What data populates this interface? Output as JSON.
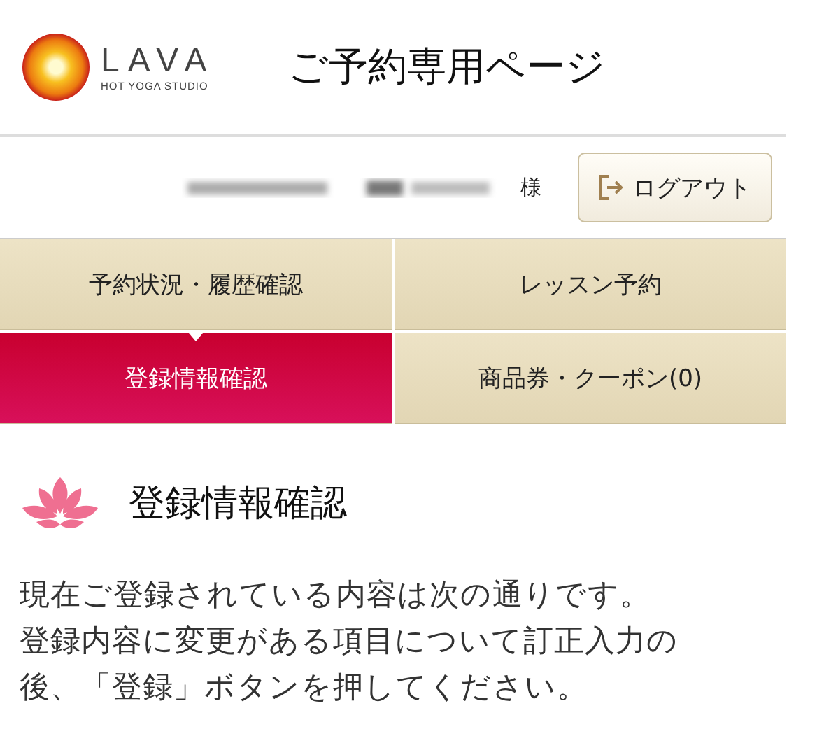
{
  "header": {
    "logo": {
      "name": "LAVA",
      "tagline": "HOT YOGA STUDIO"
    },
    "title": "ご予約専用ページ"
  },
  "user_bar": {
    "honorific": "様",
    "logout_button": "ログアウト"
  },
  "tabs": [
    {
      "label": "予約状況・履歴確認",
      "selected": false
    },
    {
      "label": "レッスン予約",
      "selected": false
    },
    {
      "label": "登録情報確認",
      "selected": true
    },
    {
      "label": "商品券・クーポン(0)",
      "selected": false
    }
  ],
  "section": {
    "heading": "登録情報確認",
    "description": [
      "現在ご登録されている内容は次の通りです。",
      "登録内容に変更がある項目について訂正入力の後、「登録」ボタンを押してください。"
    ]
  }
}
